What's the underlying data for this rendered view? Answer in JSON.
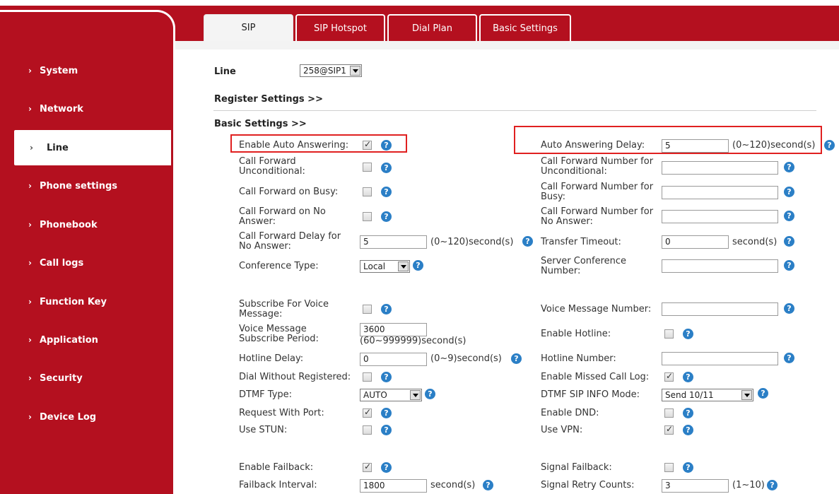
{
  "tabs": [
    {
      "label": "SIP"
    },
    {
      "label": "SIP Hotspot"
    },
    {
      "label": "Dial Plan"
    },
    {
      "label": "Basic Settings"
    }
  ],
  "sidebar": {
    "chevron": "›",
    "items": [
      {
        "label": "System"
      },
      {
        "label": "Network"
      },
      {
        "label": "Line"
      },
      {
        "label": "Phone settings"
      },
      {
        "label": "Phonebook"
      },
      {
        "label": "Call logs"
      },
      {
        "label": "Function Key"
      },
      {
        "label": "Application"
      },
      {
        "label": "Security"
      },
      {
        "label": "Device Log"
      }
    ]
  },
  "line": {
    "label": "Line",
    "value": "258@SIP1"
  },
  "sections": {
    "register": "Register Settings >>",
    "basic": "Basic Settings >>"
  },
  "help_glyph": "?",
  "left": {
    "auto_answer": "Enable Auto Answering:",
    "cf_uncond": [
      "Call Forward",
      "Unconditional:"
    ],
    "cf_busy": "Call Forward on Busy:",
    "cf_noanswer": [
      "Call Forward on No",
      "Answer:"
    ],
    "cf_delay": [
      "Call Forward Delay for",
      "No Answer:"
    ],
    "cf_delay_value": "5",
    "cf_delay_unit": "(0~120)second(s)",
    "conf_type": "Conference Type:",
    "conf_type_value": "Local",
    "sub_voice": [
      "Subscribe For Voice",
      "Message:"
    ],
    "vm_period": [
      "Voice Message",
      "Subscribe Period:"
    ],
    "vm_period_value": "3600",
    "vm_period_unit": "(60~999999)second(s)",
    "hotline_delay": "Hotline Delay:",
    "hotline_delay_value": "0",
    "hotline_delay_unit": "(0~9)second(s)",
    "dial_without_reg": "Dial Without Registered:",
    "dtmf_type": "DTMF Type:",
    "dtmf_type_value": "AUTO",
    "request_port": "Request With Port:",
    "use_stun": "Use STUN:",
    "enable_failback": "Enable Failback:",
    "failback_interval": "Failback Interval:",
    "failback_interval_value": "1800",
    "failback_interval_unit": "second(s)"
  },
  "right": {
    "auto_answer_delay": "Auto Answering Delay:",
    "auto_answer_delay_value": "5",
    "auto_answer_delay_unit": "(0~120)second(s)",
    "cfn_uncond": [
      "Call Forward Number for",
      "Unconditional:"
    ],
    "cfn_busy": [
      "Call Forward Number for",
      "Busy:"
    ],
    "cfn_noanswer": [
      "Call Forward Number for",
      "No Answer:"
    ],
    "transfer_timeout": "Transfer Timeout:",
    "transfer_timeout_value": "0",
    "transfer_timeout_unit": "second(s)",
    "server_conf": [
      "Server Conference",
      "Number:"
    ],
    "vm_number": "Voice Message Number:",
    "enable_hotline": "Enable Hotline:",
    "hotline_number": "Hotline Number:",
    "missed_call_log": "Enable Missed Call Log:",
    "dtmf_sip_info": "DTMF SIP INFO Mode:",
    "dtmf_sip_info_value": "Send 10/11",
    "enable_dnd": "Enable DND:",
    "use_vpn": "Use VPN:",
    "signal_failback": "Signal Failback:",
    "signal_retry": "Signal Retry Counts:",
    "signal_retry_value": "3",
    "signal_retry_unit": "(1~10)"
  },
  "colors": {
    "brand_red": "#b4101f",
    "highlight": "#e02020",
    "help_blue": "#2b7fc6"
  }
}
